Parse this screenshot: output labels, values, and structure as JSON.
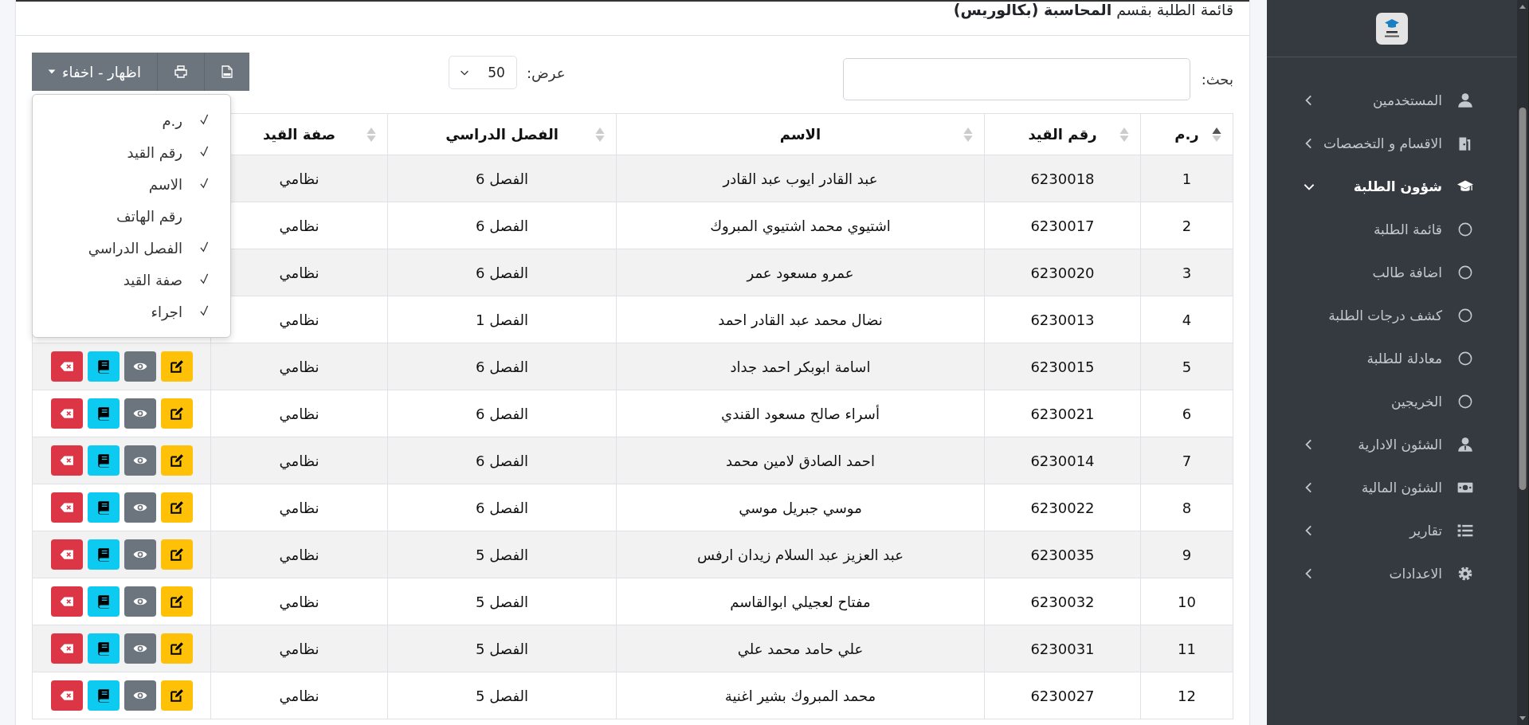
{
  "sidebar": {
    "items": [
      {
        "label": "المستخدمين",
        "expanded": false
      },
      {
        "label": "الاقسام و التخصصات",
        "expanded": false
      },
      {
        "label": "شؤون الطلبة",
        "expanded": true,
        "children": [
          {
            "label": "قائمة الطلبة"
          },
          {
            "label": "اضافة طالب"
          },
          {
            "label": "كشف درجات الطلبة"
          },
          {
            "label": "معادلة للطلبة"
          },
          {
            "label": "الخريجين"
          }
        ]
      },
      {
        "label": "الشئون الادارية",
        "expanded": false
      },
      {
        "label": "الشئون المالية",
        "expanded": false
      },
      {
        "label": "تقارير",
        "expanded": false
      },
      {
        "label": "الاعدادات",
        "expanded": false
      }
    ]
  },
  "title": "قائمة الطلبة بقسم **المحاسبة (بكالوريس)**",
  "toolbar": {
    "columns_button": "اظهار - اخفاء",
    "page_length": {
      "label": "عرض:",
      "value": "50"
    },
    "search": {
      "label": "بحث:"
    }
  },
  "column_menu": [
    {
      "label": "ر.م",
      "checked": true
    },
    {
      "label": "رقم القيد",
      "checked": true
    },
    {
      "label": "الاسم",
      "checked": true
    },
    {
      "label": "رقم الهاتف",
      "checked": false
    },
    {
      "label": "الفصل الدراسي",
      "checked": true
    },
    {
      "label": "صفة القيد",
      "checked": true
    },
    {
      "label": "اجراء",
      "checked": true
    }
  ],
  "table": {
    "columns": [
      {
        "label": "ر.م",
        "sorted": true
      },
      {
        "label": "رقم القيد",
        "sorted": false
      },
      {
        "label": "الاسم",
        "sorted": false
      },
      {
        "label": "الفصل الدراسي",
        "sorted": false
      },
      {
        "label": "صفة القيد",
        "sorted": false
      }
    ],
    "rows": [
      {
        "number": "1",
        "id": "6230018",
        "name": "عبد القادر ايوب عبد القادر",
        "semester": "الفصل 6",
        "status": "نظامي"
      },
      {
        "number": "2",
        "id": "6230017",
        "name": "اشتيوي محمد اشتيوي المبروك",
        "semester": "الفصل 6",
        "status": "نظامي"
      },
      {
        "number": "3",
        "id": "6230020",
        "name": "عمرو مسعود عمر",
        "semester": "الفصل 6",
        "status": "نظامي"
      },
      {
        "number": "4",
        "id": "6230013",
        "name": "نضال محمد عبد القادر احمد",
        "semester": "الفصل 1",
        "status": "نظامي"
      },
      {
        "number": "5",
        "id": "6230015",
        "name": "اسامة ابوبكر احمد جداد",
        "semester": "الفصل 6",
        "status": "نظامي"
      },
      {
        "number": "6",
        "id": "6230021",
        "name": "أسراء صالح مسعود القندي",
        "semester": "الفصل 6",
        "status": "نظامي"
      },
      {
        "number": "7",
        "id": "6230014",
        "name": "احمد الصادق لامين محمد",
        "semester": "الفصل 6",
        "status": "نظامي"
      },
      {
        "number": "8",
        "id": "6230022",
        "name": "موسي جبريل موسي",
        "semester": "الفصل 6",
        "status": "نظامي"
      },
      {
        "number": "9",
        "id": "6230035",
        "name": "عبد العزيز عبد السلام زيدان ارفس",
        "semester": "الفصل 5",
        "status": "نظامي"
      },
      {
        "number": "10",
        "id": "6230032",
        "name": "مفتاح لعجيلي ابوالقاسم",
        "semester": "الفصل 5",
        "status": "نظامي"
      },
      {
        "number": "11",
        "id": "6230031",
        "name": "علي حامد محمد علي",
        "semester": "الفصل 5",
        "status": "نظامي"
      },
      {
        "number": "12",
        "id": "6230027",
        "name": "محمد المبروك بشير اغنية",
        "semester": "الفصل 5",
        "status": "نظامي"
      }
    ]
  }
}
